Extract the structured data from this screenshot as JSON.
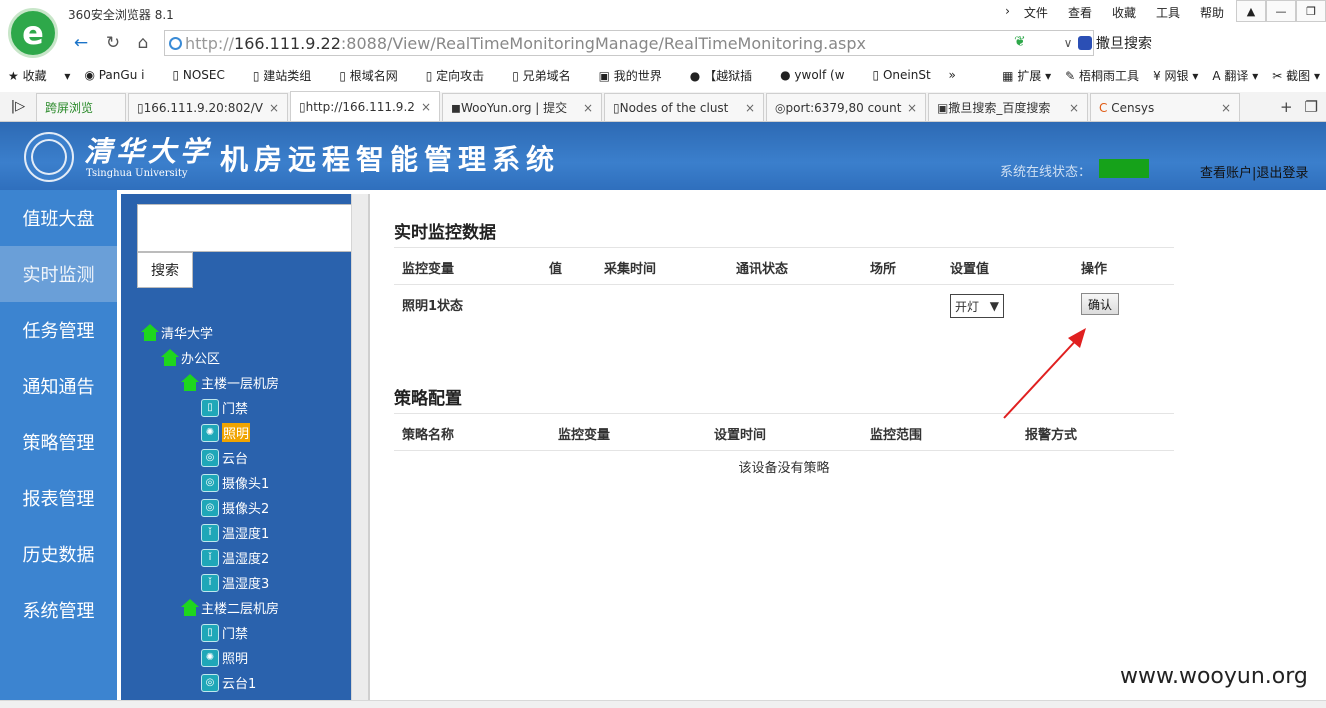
{
  "browser": {
    "app_title": "360安全浏览器 8.1",
    "menu": [
      "文件",
      "查看",
      "收藏",
      "工具",
      "帮助"
    ],
    "url_host": "166.111.9.22",
    "url_rest": ":8088/View/RealTimeMonitoringManage/RealTimeMonitoring.aspx",
    "search_engine": "撒旦搜索",
    "bookmarks": [
      "收藏",
      "PanGu i",
      "NOSEC",
      "建站类组",
      "根域名网",
      "定向攻击",
      "兄弟域名",
      "我的世界",
      "【越狱插",
      "ywolf (w",
      "OneinSt"
    ],
    "bookmark_tools": [
      "扩展",
      "梧桐雨工具",
      "网银",
      "翻译",
      "截图"
    ],
    "tabs": [
      {
        "label": "跨屏浏览",
        "active": false
      },
      {
        "label": "166.111.9.20:802/V",
        "active": false
      },
      {
        "label": "http://166.111.9.2",
        "active": true
      },
      {
        "label": "WooYun.org | 提交",
        "active": false
      },
      {
        "label": "Nodes of the clust",
        "active": false
      },
      {
        "label": "port:6379,80 count",
        "active": false
      },
      {
        "label": "撒旦搜索_百度搜索",
        "active": false
      },
      {
        "label": "Censys",
        "active": false
      }
    ]
  },
  "header": {
    "university_cn": "清华大学",
    "university_en": "Tsinghua University",
    "system_title": "机房远程智能管理系统",
    "status_label": "系统在线状态：",
    "status_color": "#16a21a",
    "account_link": "查看账户",
    "separator": "|",
    "logout_link": "退出登录"
  },
  "sidebar": {
    "items": [
      "值班大盘",
      "实时监测",
      "任务管理",
      "通知通告",
      "策略管理",
      "报表管理",
      "历史数据",
      "系统管理"
    ],
    "active_index": 1
  },
  "tree_panel": {
    "search_button": "搜索",
    "nodes": [
      {
        "label": "清华大学",
        "level": 0,
        "type": "house"
      },
      {
        "label": "办公区",
        "level": 1,
        "type": "house"
      },
      {
        "label": "主楼一层机房",
        "level": 2,
        "type": "house"
      },
      {
        "label": "门禁",
        "level": 3,
        "type": "device"
      },
      {
        "label": "照明",
        "level": 3,
        "type": "device",
        "selected": true
      },
      {
        "label": "云台",
        "level": 3,
        "type": "device"
      },
      {
        "label": "摄像头1",
        "level": 3,
        "type": "device"
      },
      {
        "label": "摄像头2",
        "level": 3,
        "type": "device"
      },
      {
        "label": "温湿度1",
        "level": 3,
        "type": "device"
      },
      {
        "label": "温湿度2",
        "level": 3,
        "type": "device"
      },
      {
        "label": "温湿度3",
        "level": 3,
        "type": "device"
      },
      {
        "label": "主楼二层机房",
        "level": 2,
        "type": "house"
      },
      {
        "label": "门禁",
        "level": 3,
        "type": "device"
      },
      {
        "label": "照明",
        "level": 3,
        "type": "device"
      },
      {
        "label": "云台1",
        "level": 3,
        "type": "device"
      }
    ]
  },
  "monitor": {
    "title": "实时监控数据",
    "columns": [
      "监控变量",
      "值",
      "采集时间",
      "通讯状态",
      "场所",
      "设置值",
      "操作"
    ],
    "rows": [
      {
        "variable": "照明1状态",
        "value": "",
        "time": "",
        "comm": "",
        "place": "",
        "setting": "开灯",
        "action": "确认"
      }
    ]
  },
  "strategy": {
    "title": "策略配置",
    "columns": [
      "策略名称",
      "监控变量",
      "设置时间",
      "监控范围",
      "报警方式"
    ],
    "empty_message": "该设备没有策略"
  },
  "watermark": "www.wooyun.org"
}
